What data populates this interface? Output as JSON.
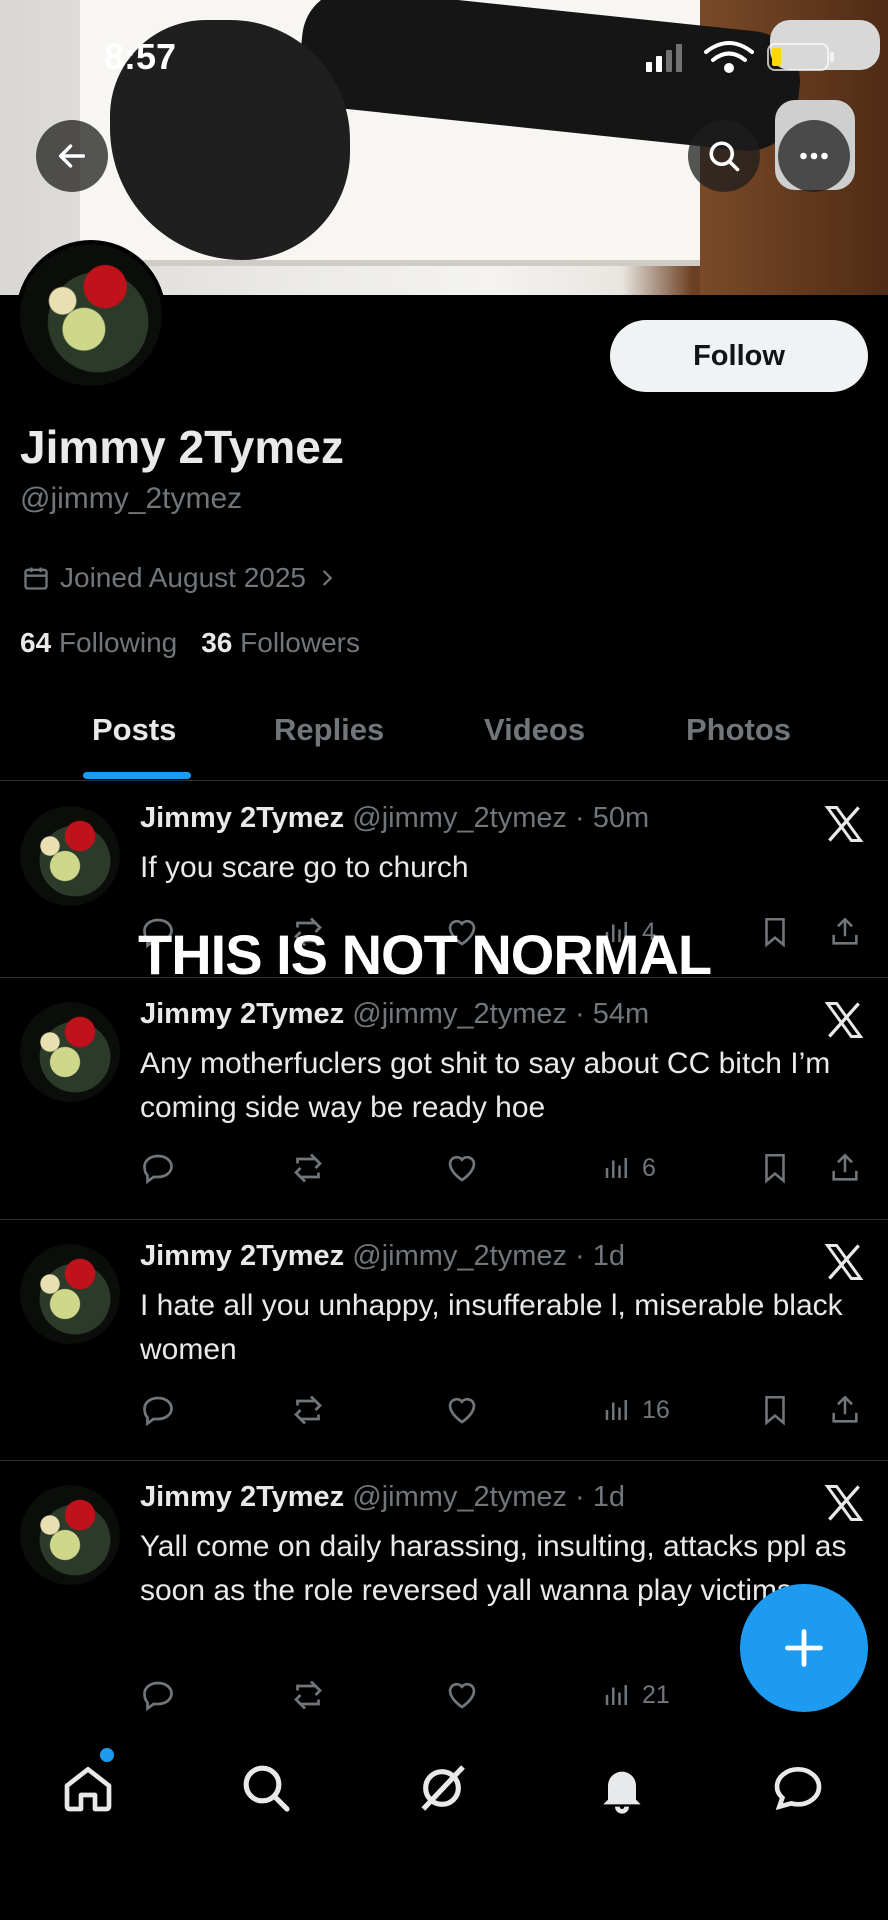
{
  "status_bar": {
    "time": "8:57"
  },
  "header": {
    "back_icon": "back-arrow-icon",
    "search_icon": "search-icon",
    "more_icon": "more-icon"
  },
  "profile": {
    "display_name": "Jimmy 2Tymez",
    "handle": "@jimmy_2tymez",
    "joined": "Joined August 2025",
    "following_count": "64",
    "following_label": "Following",
    "followers_count": "36",
    "followers_label": "Followers",
    "follow_button": "Follow"
  },
  "tabs": [
    {
      "label": "Posts",
      "active": true
    },
    {
      "label": "Replies",
      "active": false
    },
    {
      "label": "Videos",
      "active": false
    },
    {
      "label": "Photos",
      "active": false
    }
  ],
  "overlay": {
    "text": "THIS IS NOT NORMAL"
  },
  "posts": [
    {
      "name": "Jimmy 2Tymez",
      "meta": "@jimmy_2tymez · 50m",
      "text": "If you scare go to church",
      "views": "4"
    },
    {
      "name": "Jimmy 2Tymez",
      "meta": "@jimmy_2tymez · 54m",
      "text": "Any motherfuclers got shit to say about CC bitch I’m coming side way be ready hoe",
      "views": "6"
    },
    {
      "name": "Jimmy 2Tymez",
      "meta": "@jimmy_2tymez · 1d",
      "text": "I hate all you unhappy, insufferable l, miserable black women",
      "views": "16"
    },
    {
      "name": "Jimmy 2Tymez",
      "meta": "@jimmy_2tymez · 1d",
      "text": "Yall come on daily harassing, insulting, attacks ppl as soon as the role reversed yall wanna play victims",
      "views": "21"
    }
  ],
  "colors": {
    "accent": "#1d9bf0",
    "background": "#000000",
    "muted": "#71767b",
    "text": "#e7e9ea"
  }
}
